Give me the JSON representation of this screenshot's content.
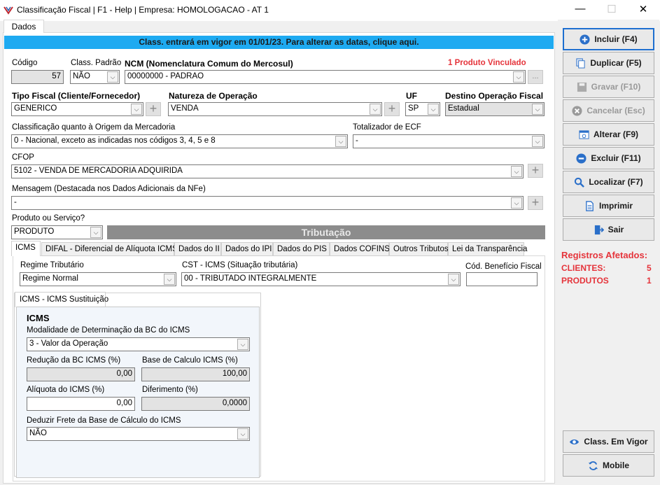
{
  "window": {
    "title": "Classificação Fiscal | F1 - Help | Empresa: HOMOLOGACAO - AT 1",
    "min": "—",
    "max": "☐",
    "close": "✕"
  },
  "tab_dados": "Dados",
  "banner": "Class. entrará em vigor em 01/01/23. Para alterar as datas, clique aqui.",
  "codigo": {
    "label": "Código",
    "value": "57"
  },
  "class_padrao": {
    "label": "Class. Padrão",
    "value": "NÃO"
  },
  "ncm": {
    "label": "NCM (Nomenclatura Comum do Mercosul)",
    "value": "00000000 - PADRAO",
    "linked": "1 Produto Vinculado",
    "more": "..."
  },
  "tipo_fiscal": {
    "label": "Tipo Fiscal (Cliente/Fornecedor)",
    "value": "GENERICO"
  },
  "natureza": {
    "label": "Natureza de Operação",
    "value": "VENDA"
  },
  "uf": {
    "label": "UF",
    "value": "SP"
  },
  "destino": {
    "label": "Destino Operação Fiscal",
    "value": "Estadual"
  },
  "origem": {
    "label": "Classificação quanto à Origem da Mercadoria",
    "value": "0 - Nacional, exceto as indicadas nos códigos 3, 4, 5 e 8"
  },
  "totalizador": {
    "label": "Totalizador de ECF",
    "value": "-"
  },
  "cfop": {
    "label": "CFOP",
    "value": "5102 - VENDA DE MERCADORIA ADQUIRIDA"
  },
  "mensagem": {
    "label": "Mensagem (Destacada nos Dados Adicionais da NFe)",
    "value": "-"
  },
  "produto_servico": {
    "label": "Produto ou Serviço?",
    "value": "PRODUTO"
  },
  "tributacao": "Tributação",
  "subtabs": [
    "ICMS",
    "DIFAL - Diferencial de Alíquota ICMS",
    "Dados do II",
    "Dados do IPI",
    "Dados do PIS",
    "Dados COFINS",
    "Outros Tributos",
    "Lei da Transparência"
  ],
  "regime": {
    "label": "Regime Tributário",
    "value": "Regime Normal"
  },
  "cst": {
    "label": "CST - ICMS (Situação tributária)",
    "value": "00 - TRIBUTADO INTEGRALMENTE"
  },
  "cod_beneficio": {
    "label": "Cód. Benefício Fiscal",
    "value": ""
  },
  "icms_tab": "ICMS - ICMS Sustituição",
  "icms": {
    "heading": "ICMS",
    "modalidade_label": "Modalidade de Determinação da BC do ICMS",
    "modalidade_value": "3 - Valor da Operação",
    "reducao_label": "Redução da BC ICMS (%)",
    "reducao_value": "0,00",
    "base_label": "Base de Calculo ICMS (%)",
    "base_value": "100,00",
    "aliquota_label": "Alíquota do ICMS (%)",
    "aliquota_value": "0,00",
    "diferimento_label": "Diferimento (%)",
    "diferimento_value": "0,0000",
    "deduzir_label": "Deduzir Frete da Base de Cálculo do ICMS",
    "deduzir_value": "NÃO"
  },
  "buttons": {
    "incluir": "Incluir (F4)",
    "duplicar": "Duplicar (F5)",
    "gravar": "Gravar (F10)",
    "cancelar": "Cancelar (Esc)",
    "alterar": "Alterar (F9)",
    "excluir": "Excluir (F11)",
    "localizar": "Localizar (F7)",
    "imprimir": "Imprimir",
    "sair": "Sair",
    "class_vigor": "Class. Em Vigor",
    "mobile": "Mobile"
  },
  "registros": {
    "title": "Registros Afetados:",
    "clientes_label": "CLIENTES:",
    "clientes_value": "5",
    "produtos_label": "PRODUTOS",
    "produtos_value": "1"
  },
  "colors": {
    "banner": "#1eaaf1",
    "accent_red": "#e5343b",
    "primary_blue": "#1e6fd0"
  }
}
